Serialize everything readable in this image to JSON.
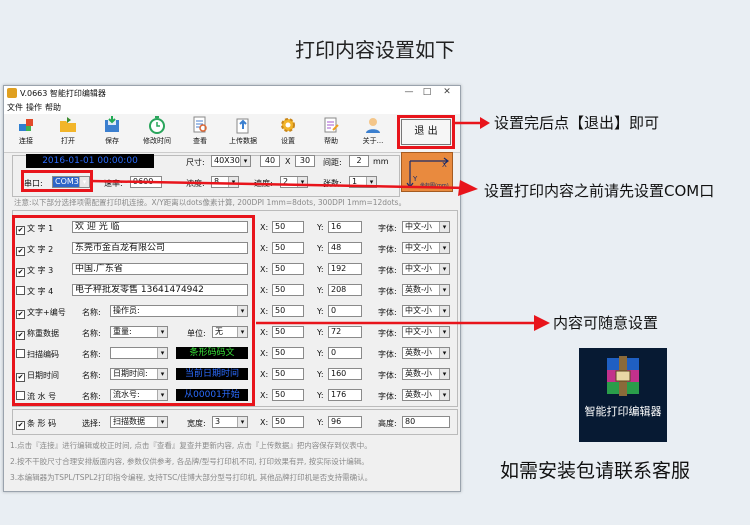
{
  "headline": "打印内容设置如下",
  "window": {
    "title": "V.0663 智能打印编辑器",
    "controls": {
      "minimize": "—",
      "maximize": "□",
      "close": "✕"
    }
  },
  "menu": [
    "文件",
    "操作",
    "帮助"
  ],
  "toolbar": [
    {
      "label": "连接",
      "icon": "connect-icon"
    },
    {
      "label": "打开",
      "icon": "folder-icon"
    },
    {
      "label": "保存",
      "icon": "save-icon"
    },
    {
      "label": "修改时间",
      "icon": "clock-icon"
    },
    {
      "label": "查看",
      "icon": "view-icon"
    },
    {
      "label": "上传数据",
      "icon": "upload-icon"
    },
    {
      "label": "设置",
      "icon": "gear-icon"
    },
    {
      "label": "帮助",
      "icon": "help-icon"
    },
    {
      "label": "关于...",
      "icon": "user-icon"
    }
  ],
  "exit_button": "退 出",
  "settings": {
    "datetime": "2016-01-01 00:00:00",
    "size_label": "尺寸:",
    "size_value": "40X30",
    "width": "40",
    "x_sep": "X",
    "height": "30",
    "gap_label": "间距:",
    "gap_value": "2",
    "gap_unit": "mm",
    "port_label": "串口:",
    "port_value": "COM3",
    "baud_label": "速率:",
    "baud_value": "9600",
    "density_label": "浓度:",
    "density_value": "8",
    "speed_label": "速度:",
    "speed_value": "2",
    "count_label": "张数:",
    "count_value": "1",
    "coord_x": "X",
    "coord_y": "Y",
    "coord_caption": "坐标图(mm)"
  },
  "notice": "注意:以下部分选择项需配置打印机连接。X/Y距离以dots像素计算, 200DPI 1mm=8dots, 300DPI 1mm=12dots。",
  "labels": {
    "name": "名称:",
    "unit": "单位:",
    "x": "X:",
    "y": "Y:",
    "font": "字体:",
    "select": "选择:",
    "width": "宽度:",
    "height": "高度:"
  },
  "rows": [
    {
      "checked": true,
      "label": "文 字 1",
      "text": "欢 迎 光 临",
      "x": "50",
      "y": "16",
      "font": "中文-小"
    },
    {
      "checked": true,
      "label": "文 字 2",
      "text": "东莞市金百龙有限公司",
      "x": "50",
      "y": "48",
      "font": "中文-小"
    },
    {
      "checked": true,
      "label": "文 字 3",
      "text": "中国.广东省",
      "x": "50",
      "y": "192",
      "font": "中文-小"
    },
    {
      "checked": false,
      "label": "文 字 4",
      "text": "电子秤批发零售 13641474942",
      "x": "50",
      "y": "208",
      "font": "英数-小"
    },
    {
      "checked": true,
      "label": "文字+编号",
      "name": "操作员:",
      "x": "50",
      "y": "0",
      "font": "中文-小"
    },
    {
      "checked": true,
      "label": "称重数据",
      "name": "重量:",
      "unit": "无",
      "x": "50",
      "y": "72",
      "font": "中文-小"
    },
    {
      "checked": false,
      "label": "扫描编码",
      "name": "",
      "display": "条形码码文",
      "x": "50",
      "y": "0",
      "font": "英数-小"
    },
    {
      "checked": true,
      "label": "日期时间",
      "name": "日期时间:",
      "display": "当前日期时间",
      "x": "50",
      "y": "160",
      "font": "英数-小"
    },
    {
      "checked": false,
      "label": "流 水 号",
      "name": "流水号:",
      "display": "从00001开始",
      "x": "50",
      "y": "176",
      "font": "英数-小"
    }
  ],
  "barcode": {
    "checked": true,
    "label": "条 形 码",
    "select_value": "扫描数据",
    "width_value": "3",
    "x": "50",
    "y": "96",
    "height_value": "80"
  },
  "footer_notes": [
    "1.点击『连接』进行编辑或校正时间, 点击『查看』复查并更新内容, 点击『上传数据』把内容保存到仪表中。",
    "2.按不干胶尺寸合理安排版面内容, 参数仅供参考, 各品牌/型号打印机不同, 打印效果有异, 按实际设计编辑。",
    "3.本编辑器为TSPL/TSPL2打印指令编程, 支持TSC/佳博大部分型号打印机, 其他品牌打印机是否支持需确认。"
  ],
  "callouts": {
    "exit": "设置完后点【退出】即可",
    "com": "设置打印内容之前请先设置COM口",
    "content": "内容可随意设置"
  },
  "app_icon_label": "智能打印编辑器",
  "service": "如需安装包请联系客服",
  "colors": {
    "red": "#e8141b",
    "dark_field": "#000000",
    "blue_text": "#2b6cff",
    "green_text": "#39e039"
  }
}
